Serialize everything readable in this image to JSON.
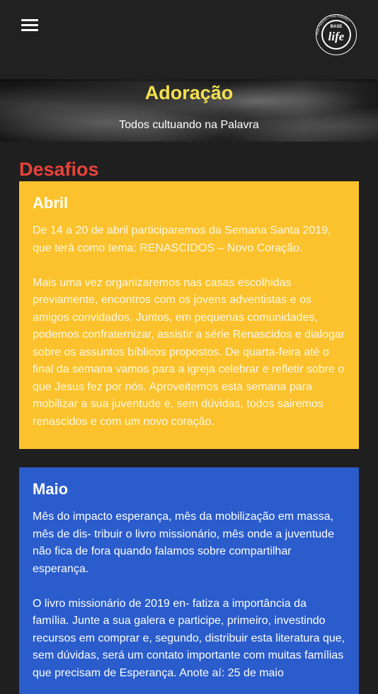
{
  "header": {
    "menu_icon": "hamburger-menu-icon",
    "logo_text": "life",
    "logo_top_text": "BASE",
    "logo_ring_text": "Pela Palavra • Pela Palavra •"
  },
  "hero": {
    "title": "Adoração",
    "subtitle": "Todos cultuando na Palavra"
  },
  "section": {
    "title": "Desafios"
  },
  "cards": [
    {
      "title": "Abril",
      "color": "#fbc22d",
      "paragraphs": [
        "De 14 a 20 de abril participaremos da Semana Santa 2019, que terá como tema: RENASCIDOS – Novo Coração.",
        "Mais uma vez organizaremos nas casas escolhidas previamente, encontros com os jovens adventistas e os amigos convidados. Juntos, em pequenas comunidades, podemos confraternizar, assistir a série Renascidos e dialogar sobre os assuntos bíblicos propostos. De quarta-feira até o final da semana vamos para a igreja celebrar e refletir sobre o que Jesus fez por nós. Aproveitemos esta semana para mobilizar a sua juventude e, sem dúvidas, todos sairemos renascidos e com um novo coração."
      ]
    },
    {
      "title": "Maio",
      "color": "#2a5ccc",
      "paragraphs": [
        "Mês do impacto esperança, mês da mobilização em massa, mês de dis- tribuir o livro missionário, mês onde a juventude não fica de fora quando falamos sobre compartilhar esperança.",
        "O livro missionário de 2019 en- fatiza a importância da família. Junte a sua galera e participe, primeiro, investindo recursos em comprar e, segundo, distribuir esta literatura que, sem dúvidas, será um contato importante com muitas famílias que precisam de Esperança. Anote aí: 25 de maio"
      ]
    }
  ]
}
